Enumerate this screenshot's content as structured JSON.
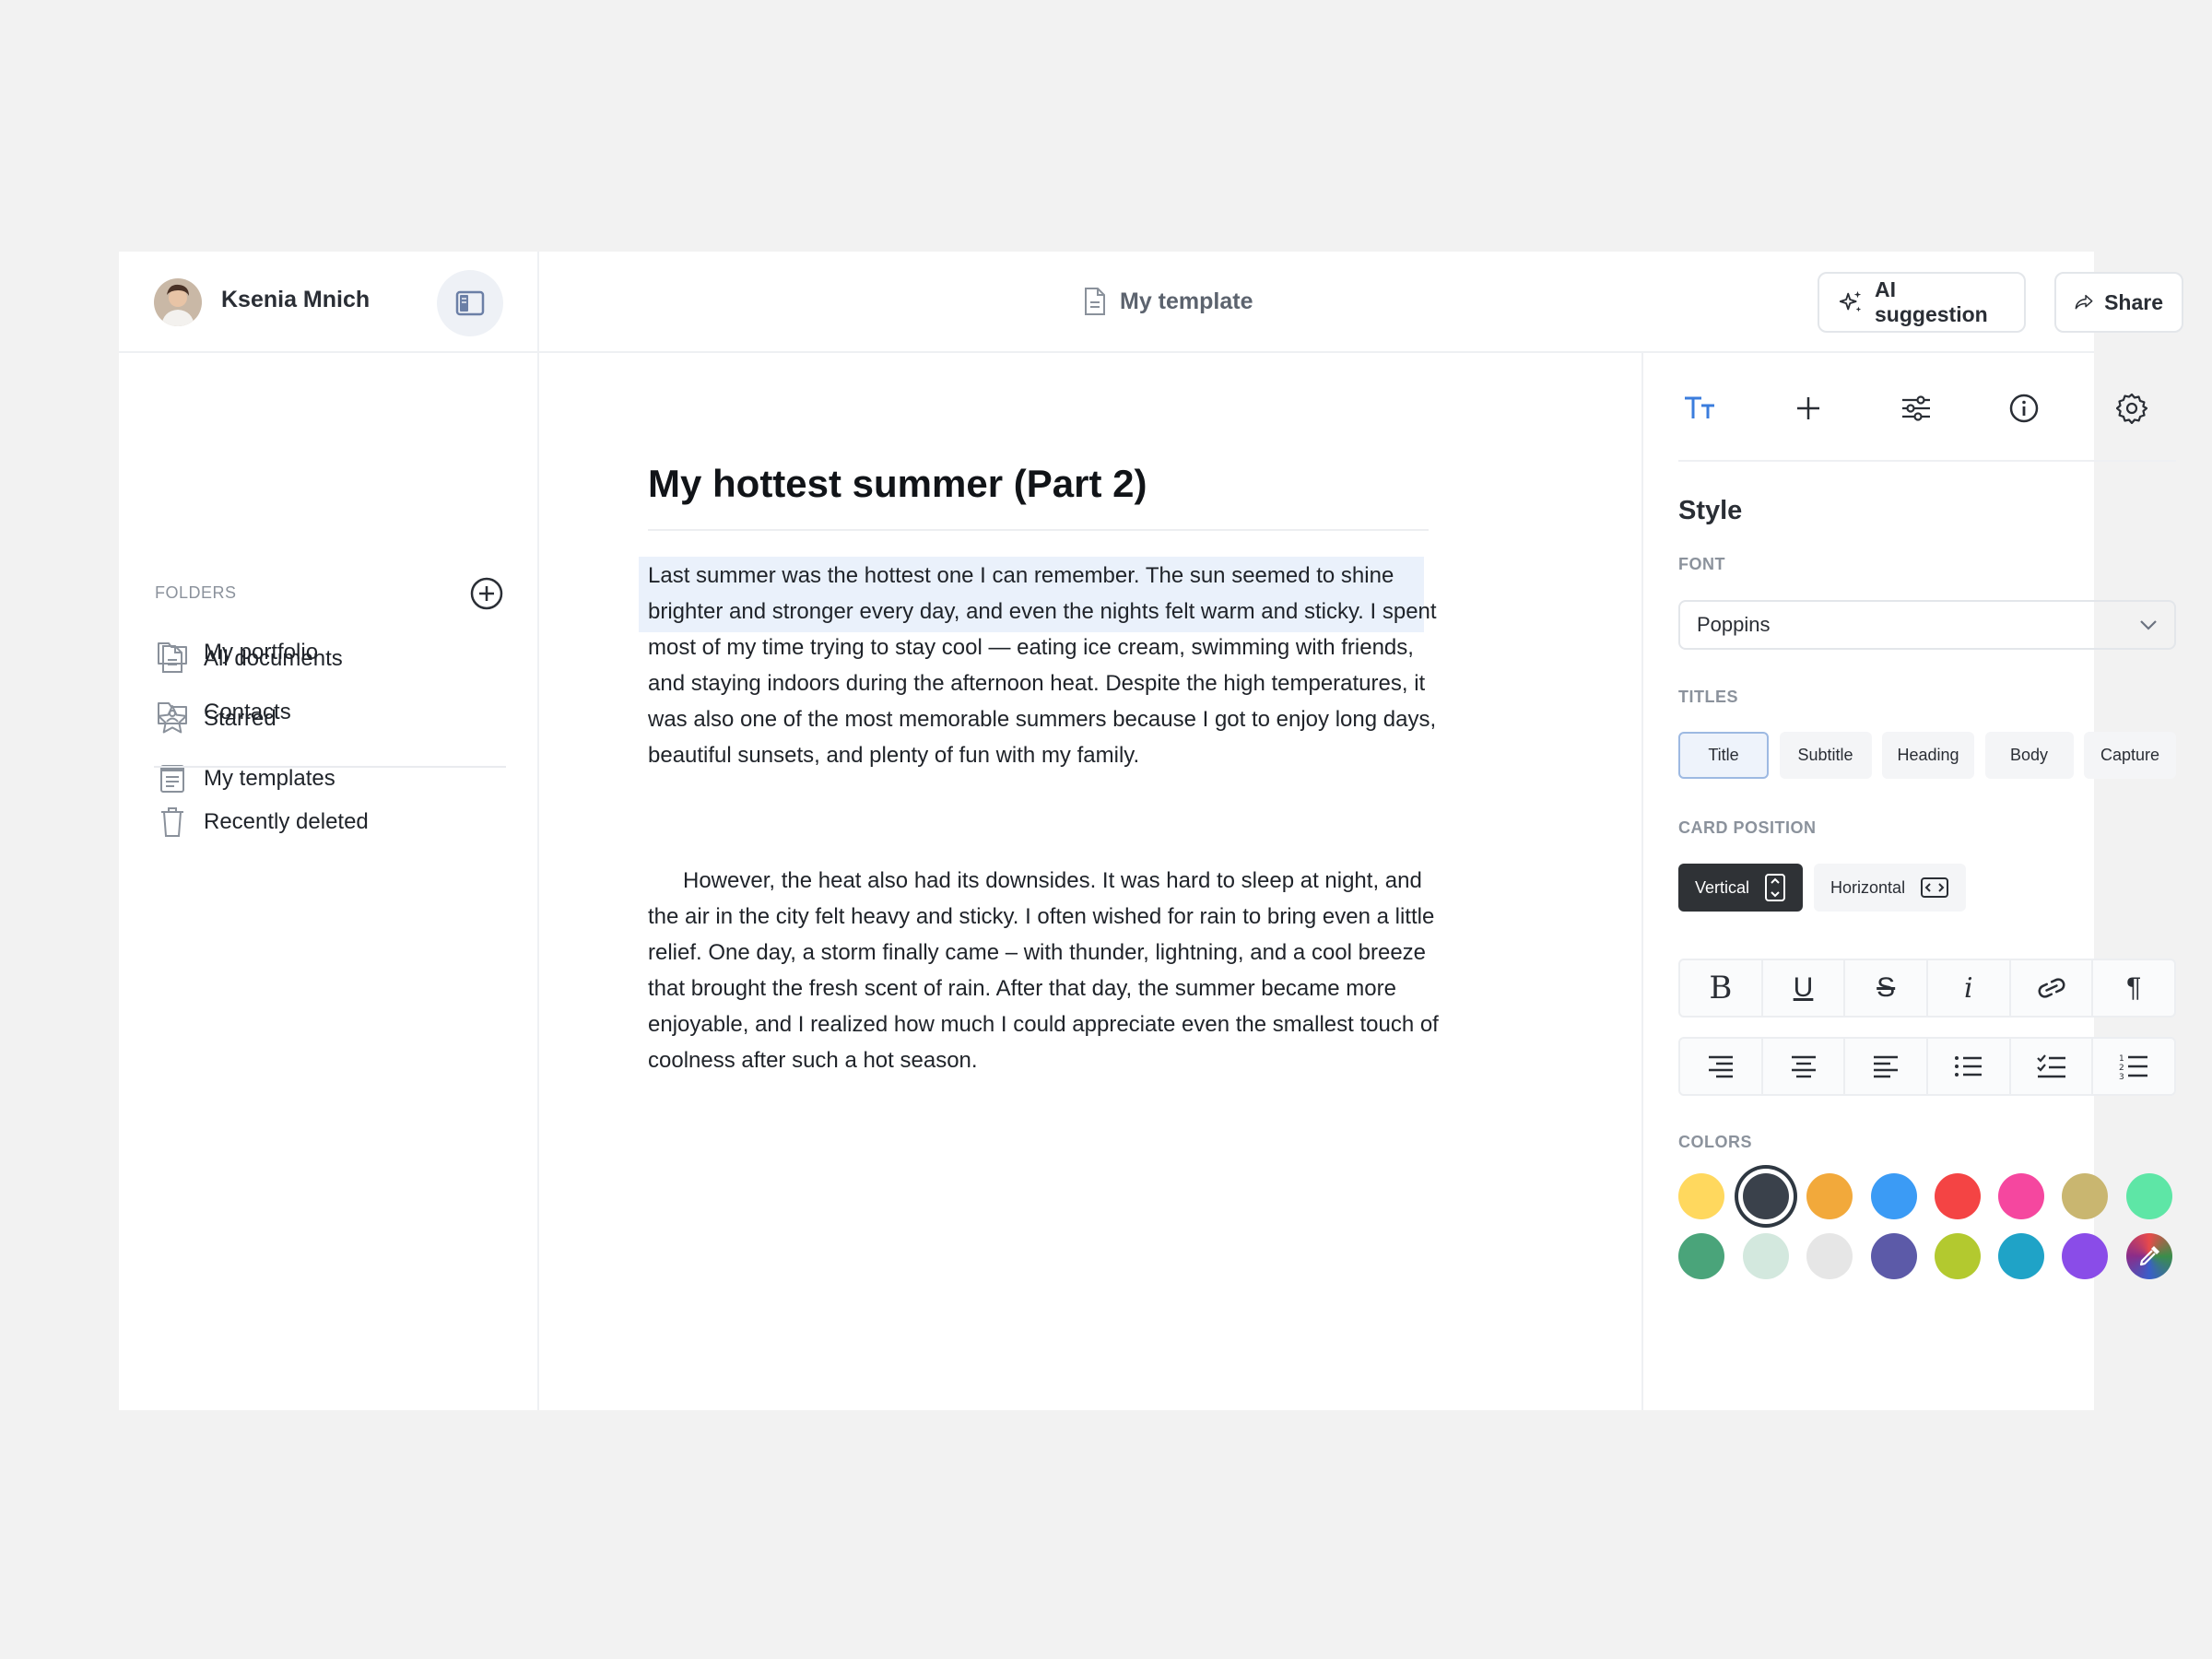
{
  "user": {
    "name": "Ksenia Mnich"
  },
  "document": {
    "title": "My template"
  },
  "sidebar": {
    "items": [
      {
        "label": "All documents",
        "icon": "document-icon"
      },
      {
        "label": "Starred",
        "icon": "star-icon"
      },
      {
        "label": "My templates",
        "icon": "template-icon"
      }
    ],
    "folders_label": "FOLDERS",
    "folders": [
      {
        "label": "My portfolio",
        "icon": "folder-icon"
      },
      {
        "label": "Contacts",
        "icon": "contacts-folder-icon"
      }
    ],
    "recently_deleted": "Recently deleted"
  },
  "toolbar": {
    "ai_label": "AI suggestion",
    "share_label": "Share"
  },
  "editor": {
    "heading": "My hottest summer (Part 2)",
    "paragraph_1": "Last summer was the hottest one I can remember. The sun seemed to shine brighter and stronger every day, and even the nights felt warm and sticky. I spent most of my time trying to stay cool — eating ice cream, swimming with friends, and staying indoors during the afternoon heat. Despite the high temperatures, it was also one of the most memorable summers because I got to enjoy long days, beautiful sunsets, and plenty of fun with my family.",
    "paragraph_2": "However, the heat also had its downsides. It was hard to sleep at night, and the air in the city felt heavy and sticky. I often wished for rain to bring even a little relief. One day, a storm finally came – with thunder, lightning, and a cool breeze that brought the fresh scent of rain. After that day, the summer became more enjoyable, and I realized how much I could appreciate even the smallest touch of coolness after such a hot season."
  },
  "panel": {
    "tabs": [
      "text-style-icon",
      "plus-icon",
      "sliders-icon",
      "info-icon",
      "gear-icon"
    ],
    "heading": "Style",
    "font_label": "FONT",
    "font_value": "Poppins",
    "titles_label": "TITLES",
    "titles": [
      "Title",
      "Subtitle",
      "Heading",
      "Body",
      "Capture"
    ],
    "titles_selected": "Title",
    "card_position_label": "CARD POSITION",
    "positions": [
      "Vertical",
      "Horizontal"
    ],
    "position_selected": "Vertical",
    "format_tools": [
      "bold-icon",
      "underline-icon",
      "strikethrough-icon",
      "italic-icon",
      "link-icon",
      "paragraph-icon"
    ],
    "format_glyphs": [
      "B",
      "U",
      "S",
      "i",
      "",
      "¶"
    ],
    "list_tools": [
      "align-right-icon",
      "align-center-icon",
      "align-left-icon",
      "bullet-list-icon",
      "checklist-icon",
      "numbered-list-icon"
    ],
    "colors_label": "COLORS",
    "colors": [
      "#FFD85E",
      "#3A414B",
      "#F2A93B",
      "#3B9BF5",
      "#F44444",
      "#F5479F",
      "#C9B670",
      "#5EE6A6",
      "#4AA47A",
      "#D3E8DE",
      "#E6E6E6",
      "#5C5AA8",
      "#B3C92F",
      "#1FA3C7",
      "#8A4CE8"
    ],
    "color_selected": "#3A414B",
    "accent": "#3B7DDD"
  }
}
